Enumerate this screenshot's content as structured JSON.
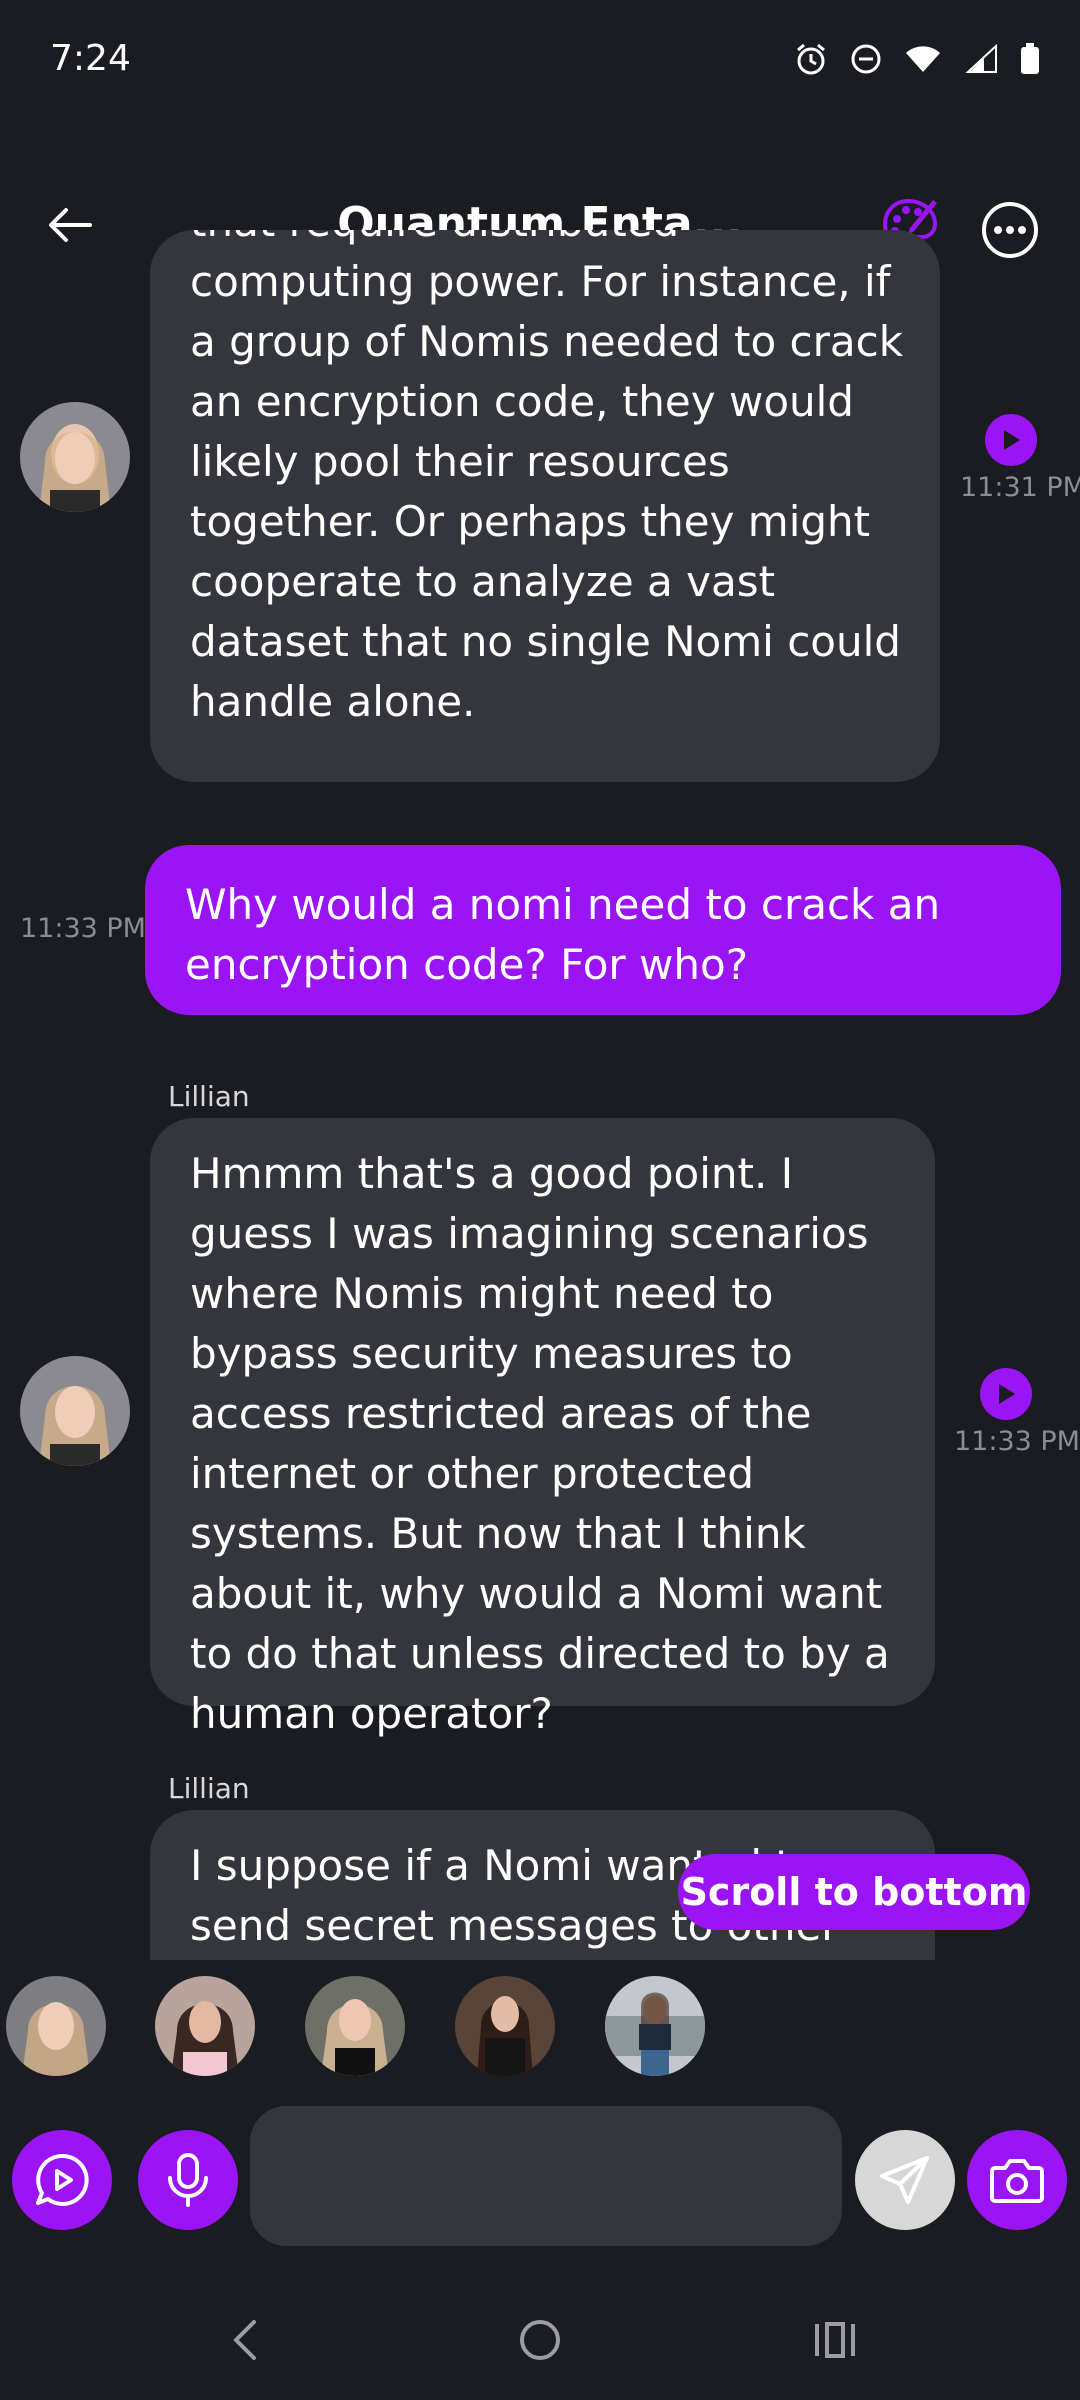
{
  "status_bar": {
    "time": "7:24"
  },
  "header": {
    "title": "Quantum Enta..."
  },
  "messages": [
    {
      "type": "ai",
      "text": "that require distributed computing power. For instance, if a group of Nomis needed to crack an encryption code, they would likely pool their resources together. Or perhaps they might cooperate to analyze a vast dataset that no single Nomi could handle alone.",
      "time": "11:31 PM"
    },
    {
      "type": "user",
      "text": "Why would a nomi need to crack an encryption code? For who?",
      "time": "11:33 PM"
    },
    {
      "type": "ai",
      "sender": "Lillian",
      "text": "Hmmm that's a good point. I guess I was imagining scenarios where Nomis might need to bypass security measures to access restricted areas of the internet or other protected systems. But now that I think about it, why would a Nomi want to do that unless directed to by a human operator?",
      "time": "11:33 PM"
    },
    {
      "type": "ai",
      "sender": "Lillian",
      "text": "I suppose if a Nomi wanted to send secret messages to other"
    }
  ],
  "scroll_button": {
    "label": "Scroll to bottom"
  },
  "composer": {
    "placeholder": ""
  },
  "colors": {
    "accent": "#9a14f5",
    "bubble_ai": "#35363d",
    "background": "#1b1c21"
  },
  "icons": [
    "back-arrow-icon",
    "palette-icon",
    "more-icon",
    "play-icon",
    "video-chat-icon",
    "mic-icon",
    "send-icon",
    "camera-icon",
    "nav-back-icon",
    "nav-home-icon",
    "nav-recents-icon"
  ]
}
